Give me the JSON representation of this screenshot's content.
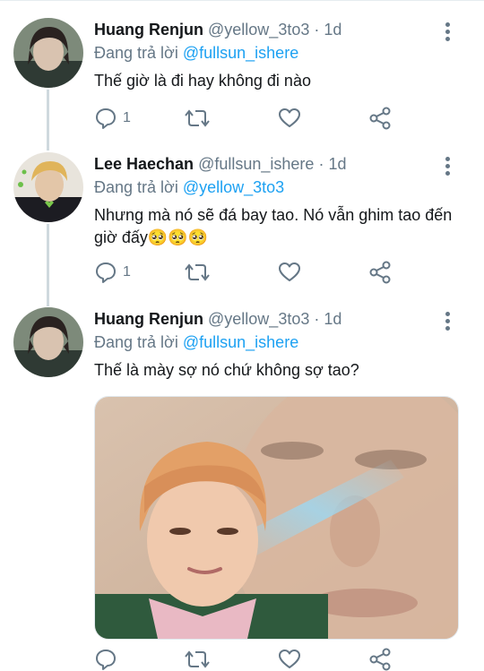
{
  "tweets": [
    {
      "name": "Huang Renjun",
      "handle": "@yellow_3to3",
      "separator": "·",
      "time": "1d",
      "replying_prefix": "Đang trả lời",
      "replying_to": "@fullsun_ishere",
      "text": "Thế giờ là đi hay không đi nào",
      "reply_count": "1"
    },
    {
      "name": "Lee Haechan",
      "handle": "@fullsun_ishere",
      "separator": "·",
      "time": "1d",
      "replying_prefix": "Đang trả lời",
      "replying_to": "@yellow_3to3",
      "text": "Nhưng mà nó sẽ đá bay tao. Nó vẫn ghim tao đến giờ đấy🥺🥺🥺",
      "reply_count": "1"
    },
    {
      "name": "Huang Renjun",
      "handle": "@yellow_3to3",
      "separator": "·",
      "time": "1d",
      "replying_prefix": "Đang trả lời",
      "replying_to": "@fullsun_ishere",
      "text": "Thế là mày sợ nó chứ không sợ tao?",
      "reply_count": ""
    }
  ],
  "colors": {
    "mention": "#1da1f2",
    "secondary_text": "#657786",
    "thread_line": "#cfd9de"
  },
  "icons": [
    "reply-icon",
    "retweet-icon",
    "like-icon",
    "share-icon",
    "more-icon"
  ]
}
